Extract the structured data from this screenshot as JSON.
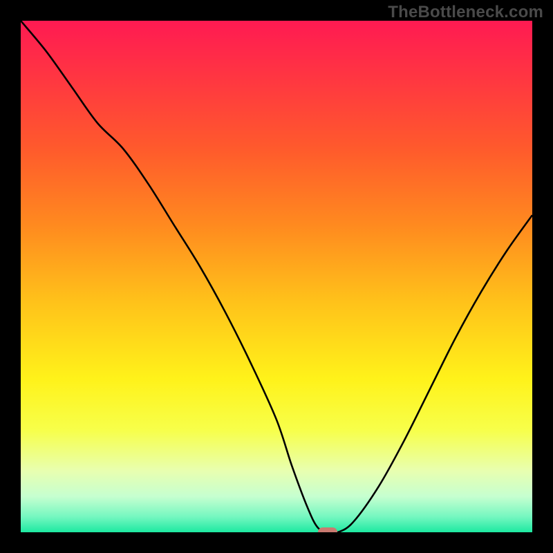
{
  "watermark": "TheBottleneck.com",
  "colors": {
    "frame_bg": "#000000",
    "curve_stroke": "#000000",
    "marker_fill": "#c97a70",
    "gradient_stops": [
      {
        "offset": 0.0,
        "color": "#ff1a52"
      },
      {
        "offset": 0.12,
        "color": "#ff3840"
      },
      {
        "offset": 0.25,
        "color": "#ff5a2c"
      },
      {
        "offset": 0.4,
        "color": "#ff8a1f"
      },
      {
        "offset": 0.55,
        "color": "#ffc21a"
      },
      {
        "offset": 0.7,
        "color": "#fff21a"
      },
      {
        "offset": 0.8,
        "color": "#f7ff4a"
      },
      {
        "offset": 0.88,
        "color": "#e8ffb0"
      },
      {
        "offset": 0.93,
        "color": "#c6ffd0"
      },
      {
        "offset": 0.97,
        "color": "#74f7c0"
      },
      {
        "offset": 1.0,
        "color": "#1de9a1"
      }
    ]
  },
  "chart_data": {
    "type": "line",
    "title": "",
    "xlabel": "",
    "ylabel": "",
    "xlim": [
      0,
      100
    ],
    "ylim": [
      0,
      100
    ],
    "series": [
      {
        "name": "bottleneck-curve",
        "x": [
          0,
          5,
          10,
          15,
          20,
          25,
          30,
          35,
          40,
          45,
          50,
          53,
          56,
          58,
          60,
          62,
          65,
          70,
          75,
          80,
          85,
          90,
          95,
          100
        ],
        "y": [
          100,
          94,
          87,
          80,
          75,
          68,
          60,
          52,
          43,
          33,
          22,
          13,
          5,
          1,
          0,
          0,
          2,
          9,
          18,
          28,
          38,
          47,
          55,
          62
        ]
      }
    ],
    "marker": {
      "x": 60,
      "y": 0
    },
    "floor_y": 0
  }
}
